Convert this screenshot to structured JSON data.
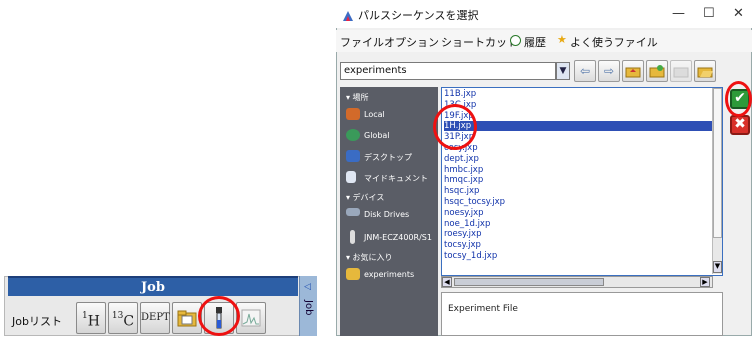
{
  "job_panel": {
    "title": "Job",
    "label": "Jobリスト",
    "buttons": [
      {
        "name": "1h-button",
        "sup": "1",
        "text": "H"
      },
      {
        "name": "13c-button",
        "sup": "13",
        "text": "C"
      },
      {
        "name": "dept-button",
        "sup": "",
        "text": "DEPT"
      }
    ],
    "side_tab": "Job"
  },
  "dialog": {
    "title": "パルスシーケンスを選択",
    "menu": [
      "ファイル",
      "オプション",
      "ショートカット",
      "履歴",
      "よく使うファイル"
    ],
    "path_value": "experiments",
    "sidebar": {
      "section_places": "▾ 場所",
      "places": [
        "Local",
        "Global",
        "デスクトップ",
        "マイドキュメント"
      ],
      "section_devices": "▾ デバイス",
      "devices": [
        "Disk Drives",
        "JNM-ECZ400R/S1"
      ],
      "section_favorites": "▾ お気に入り",
      "favorites": [
        "experiments"
      ]
    },
    "files": [
      "11B.jxp",
      "13C.jxp",
      "19F.jxp",
      "1H.jxp",
      "31P.jxp",
      "cosy.jxp",
      "dept.jxp",
      "hmbc.jxp",
      "hmqc.jxp",
      "hsqc.jxp",
      "hsqc_tocsy.jxp",
      "noesy.jxp",
      "noe_1d.jxp",
      "roesy.jxp",
      "tocsy.jxp",
      "tocsy_1d.jxp"
    ],
    "selected_file": "1H.jxp",
    "preview_text": "Experiment File",
    "colors": {
      "selection": "#2e4fb5",
      "sidebar": "#5a5d66",
      "highlight_circle": "#ee1111"
    }
  }
}
